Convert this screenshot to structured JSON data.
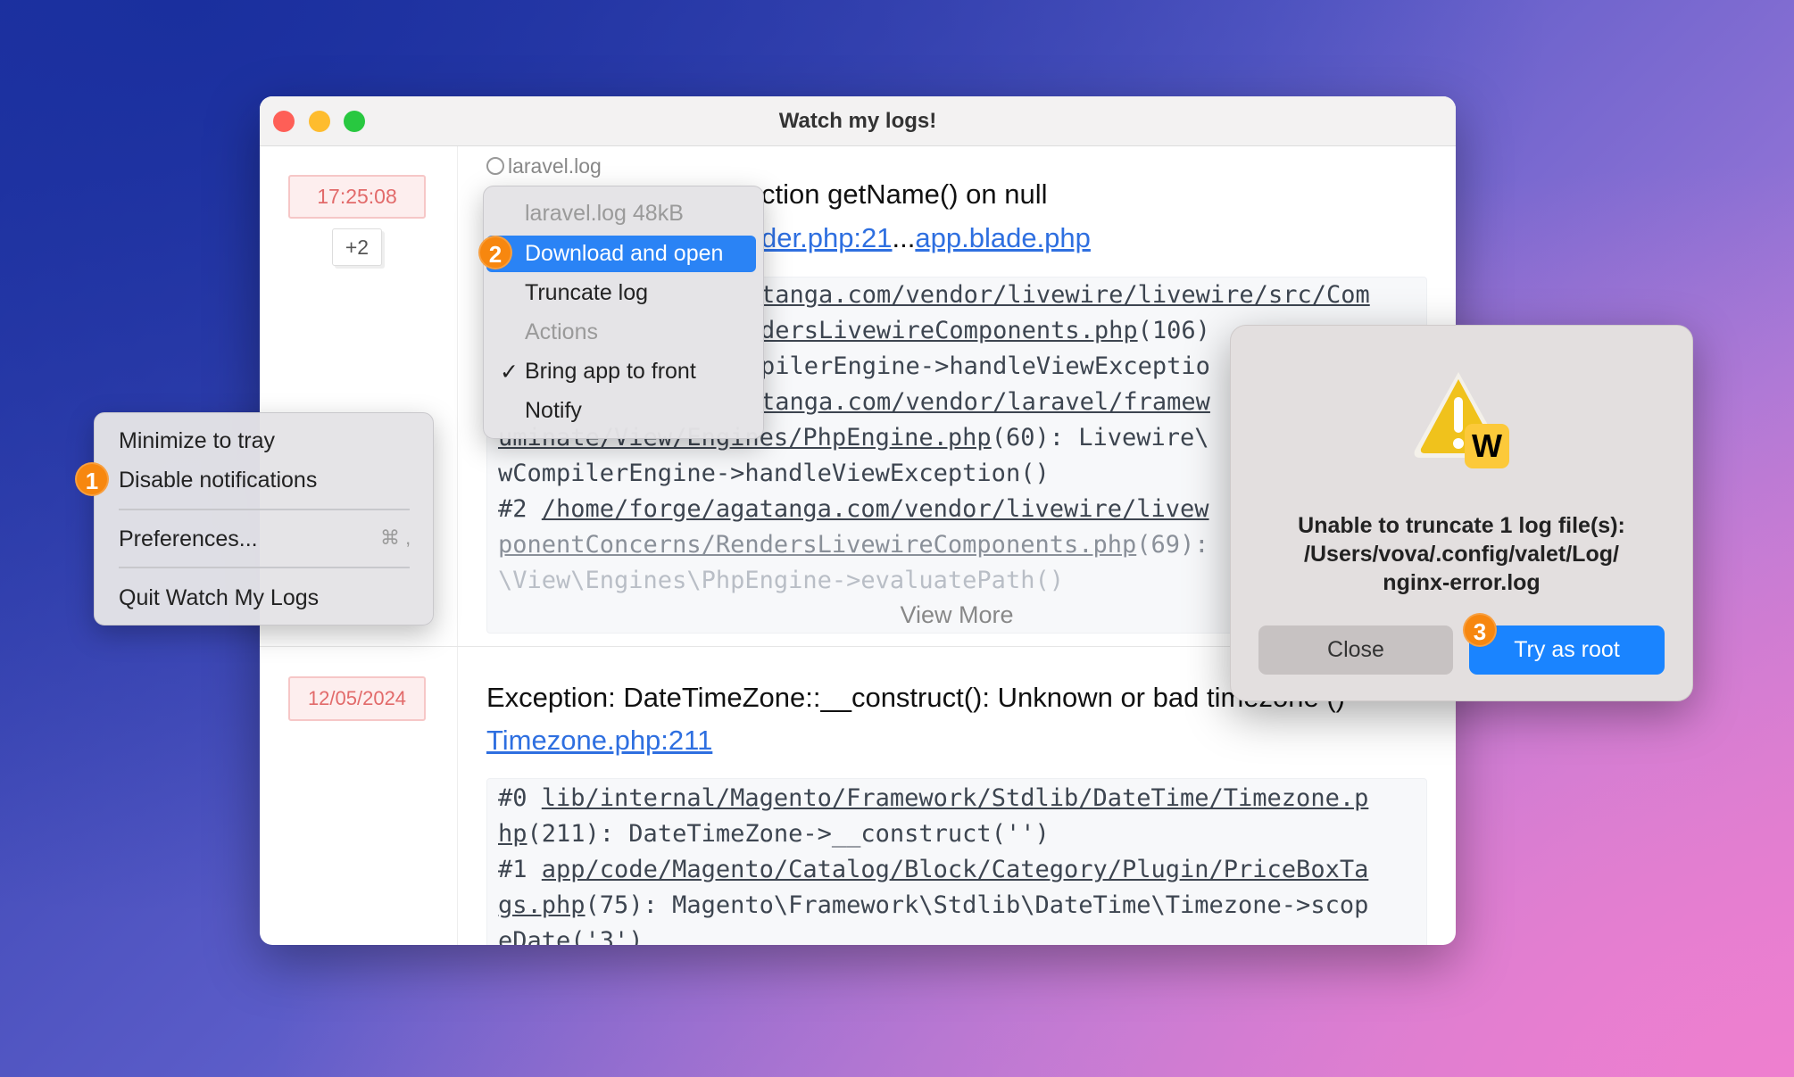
{
  "window": {
    "title": "Watch my logs!"
  },
  "entries": [
    {
      "time": "17:25:08",
      "more": "+2",
      "source": "log-icon",
      "source_name": "laravel.log",
      "title_visible": "ction getName() on null",
      "link1": "der.php:21",
      "link_sep": "...",
      "link2": "app.blade.php",
      "lines": [
        "tanga.com/vendor/livewire/livewire/src/Com",
        "dersLivewireComponents.php",
        "(106)",
        "pilerEngine->handleViewExceptio",
        "tanga.com/vendor/laravel/framew",
        "uminate/View/Engines/PhpEngine.php",
        "(60): Livewire\\",
        "wCompilerEngine->handleViewException()",
        "#2 ",
        "/home/forge/agatanga.com/vendor/livewire/livew",
        "ponentConcerns/RendersLivewireComponents.php",
        "(69):",
        "\\View\\Engines\\PhpEngine->evaluatePath()"
      ],
      "view_more": "View More"
    },
    {
      "time": "12/05/2024",
      "title": "Exception: DateTimeZone::__construct(): Unknown or bad timezone ()",
      "link": "Timezone.php:211",
      "lines": [
        "#0 ",
        "lib/internal/Magento/Framework/Stdlib/DateTime/Timezone.p",
        "hp",
        "(211): DateTimeZone->__construct('')",
        "#1 ",
        "app/code/Magento/Catalog/Block/Category/Plugin/PriceBoxTa",
        "gs.php",
        "(75): Magento\\Framework\\Stdlib\\DateTime\\Timezone->scop",
        "eDate('3')"
      ]
    }
  ],
  "log_menu": {
    "header": "laravel.log 48kB",
    "items": [
      "Download and open",
      "Truncate log"
    ],
    "section": "Actions",
    "toggles": [
      "Bring app to front",
      "Notify"
    ],
    "checkmark": "✓",
    "step": "2"
  },
  "tray_menu": {
    "items": [
      "Minimize to tray",
      "Disable notifications"
    ],
    "preferences": "Preferences...",
    "shortcut": "⌘ ,",
    "quit": "Quit Watch My Logs",
    "step": "1"
  },
  "dialog": {
    "icon": "warning-icon",
    "badge": "W",
    "lines": [
      "Unable to truncate 1 log file(s):",
      "/Users/vova/.config/valet/Log/",
      "nginx-error.log"
    ],
    "close": "Close",
    "confirm": "Try as root",
    "step": "3"
  },
  "colors": {
    "accent": "#1a84ff",
    "step_badge": "#f7870f",
    "time_badge": "#e26a6a"
  }
}
